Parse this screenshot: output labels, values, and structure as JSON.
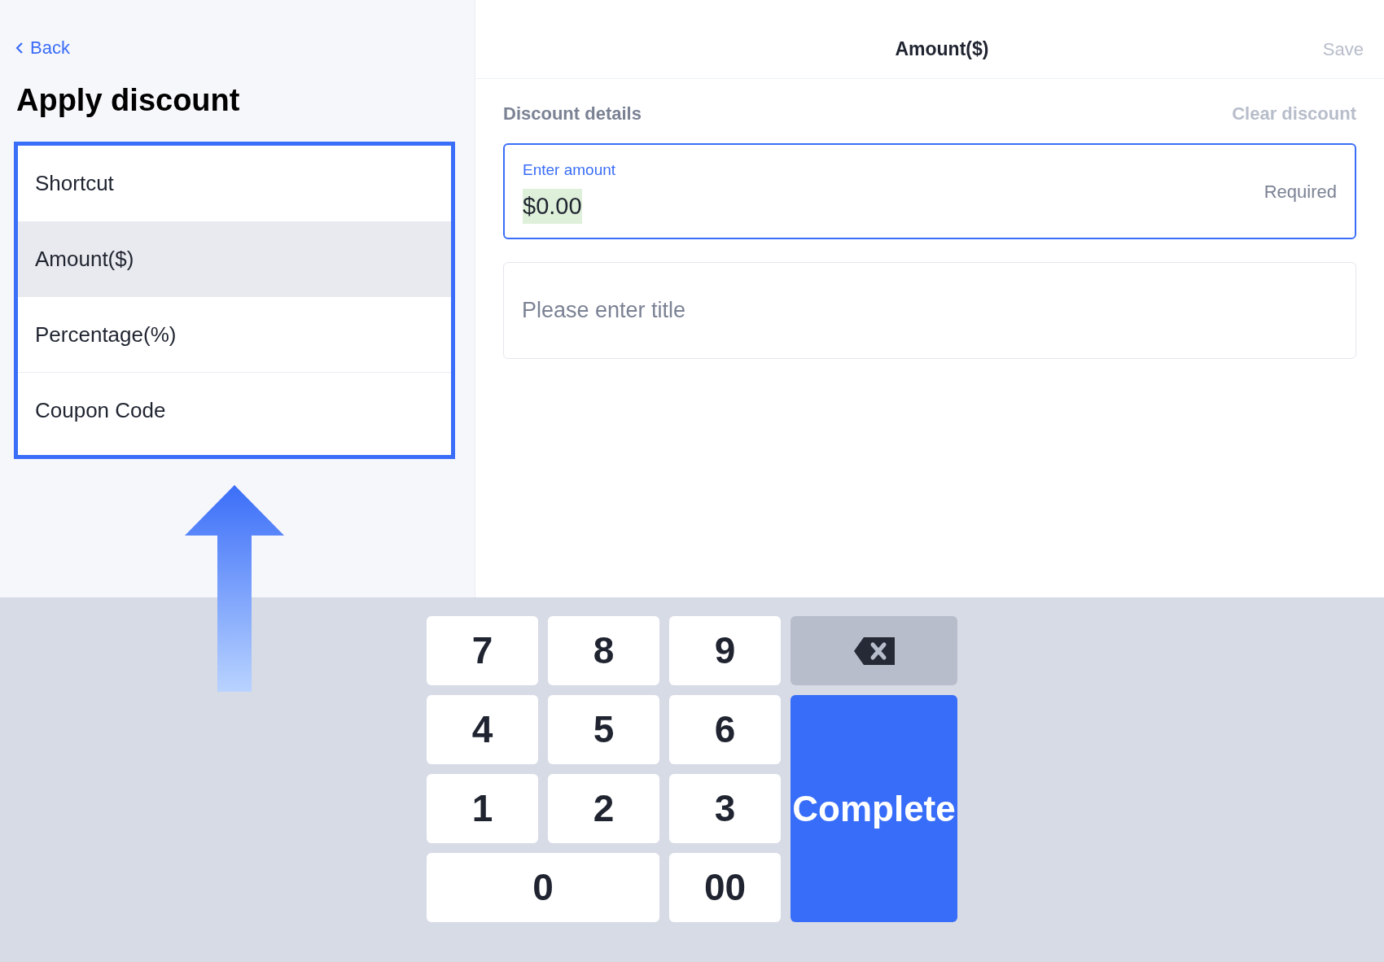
{
  "back": {
    "label": "Back"
  },
  "title": "Apply discount",
  "options": [
    {
      "label": "Shortcut",
      "selected": false
    },
    {
      "label": "Amount($)",
      "selected": true
    },
    {
      "label": "Percentage(%)",
      "selected": false
    },
    {
      "label": "Coupon Code",
      "selected": false
    }
  ],
  "header": {
    "title": "Amount($)",
    "save": {
      "label": "Save",
      "disabled": true
    }
  },
  "section": {
    "title": "Discount details",
    "clear": {
      "label": "Clear discount",
      "disabled": true
    }
  },
  "amount_field": {
    "label": "Enter amount",
    "value": "$0.00",
    "hint": "Required",
    "focused": true,
    "value_selected": true
  },
  "title_field": {
    "placeholder": "Please enter title"
  },
  "keypad": [
    {
      "kind": "digit",
      "label": "7"
    },
    {
      "kind": "digit",
      "label": "8"
    },
    {
      "kind": "digit",
      "label": "9"
    },
    {
      "kind": "backspace"
    },
    {
      "kind": "digit",
      "label": "4"
    },
    {
      "kind": "digit",
      "label": "5"
    },
    {
      "kind": "digit",
      "label": "6"
    },
    {
      "kind": "digit",
      "label": "1"
    },
    {
      "kind": "digit",
      "label": "2"
    },
    {
      "kind": "digit",
      "label": "3"
    },
    {
      "kind": "complete",
      "label": "Complete"
    },
    {
      "kind": "wide",
      "label": "0"
    },
    {
      "kind": "digit",
      "label": "00"
    }
  ]
}
